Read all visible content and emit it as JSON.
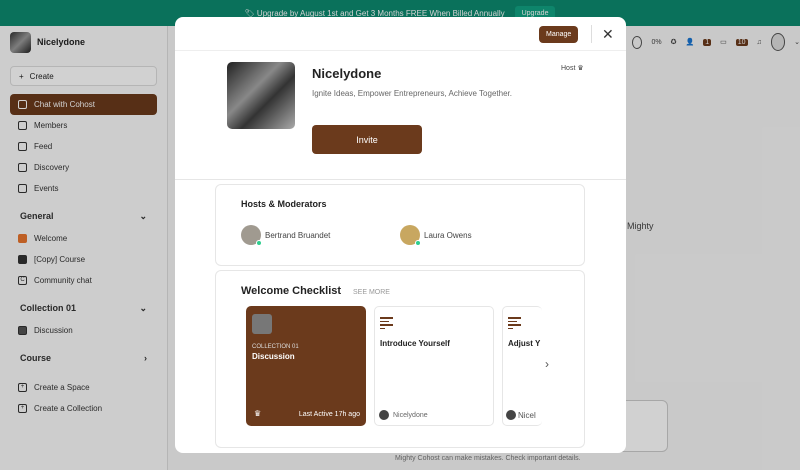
{
  "banner": {
    "text": "🏷 Upgrade by August 1st and Get 3 Months FREE When Billed Annually",
    "button": "Upgrade"
  },
  "sidebar": {
    "brand": "Nicelydone",
    "create": "Create",
    "items": [
      {
        "label": "Chat with Cohost",
        "icon": "chat-icon"
      },
      {
        "label": "Members",
        "icon": "members-icon"
      },
      {
        "label": "Feed",
        "icon": "feed-icon"
      },
      {
        "label": "Discovery",
        "icon": "compass-icon"
      },
      {
        "label": "Events",
        "icon": "calendar-icon"
      }
    ],
    "sections": [
      {
        "title": "General",
        "items": [
          "Welcome",
          "[Copy] Course",
          "Community chat"
        ]
      },
      {
        "title": "Collection 01",
        "items": [
          "Discussion"
        ]
      },
      {
        "title": "Course",
        "items": []
      }
    ],
    "footer": [
      "Create a Space",
      "Create a Collection"
    ]
  },
  "topbar": {
    "progress": "0%",
    "badge1": "1",
    "badge2": "10"
  },
  "background": {
    "mighty": "Mighty",
    "disclaimer": "Mighty Cohost can make mistakes. Check important details."
  },
  "modal": {
    "manage": "Manage",
    "host": "Host",
    "title": "Nicelydone",
    "tagline": "Ignite Ideas, Empower Entrepreneurs, Achieve Together.",
    "invite": "Invite",
    "hosts_title": "Hosts & Moderators",
    "hosts": [
      "Bertrand Bruandet",
      "Laura Owens"
    ],
    "checklist_title": "Welcome Checklist",
    "see_more": "SEE MORE",
    "cards": [
      {
        "kicker": "COLLECTION 01",
        "title": "Discussion",
        "meta": "Last Active 17h ago"
      },
      {
        "title": "Introduce Yourself",
        "author": "Nicelydone"
      },
      {
        "title": "Adjust Y",
        "author": "Nicel"
      }
    ]
  }
}
